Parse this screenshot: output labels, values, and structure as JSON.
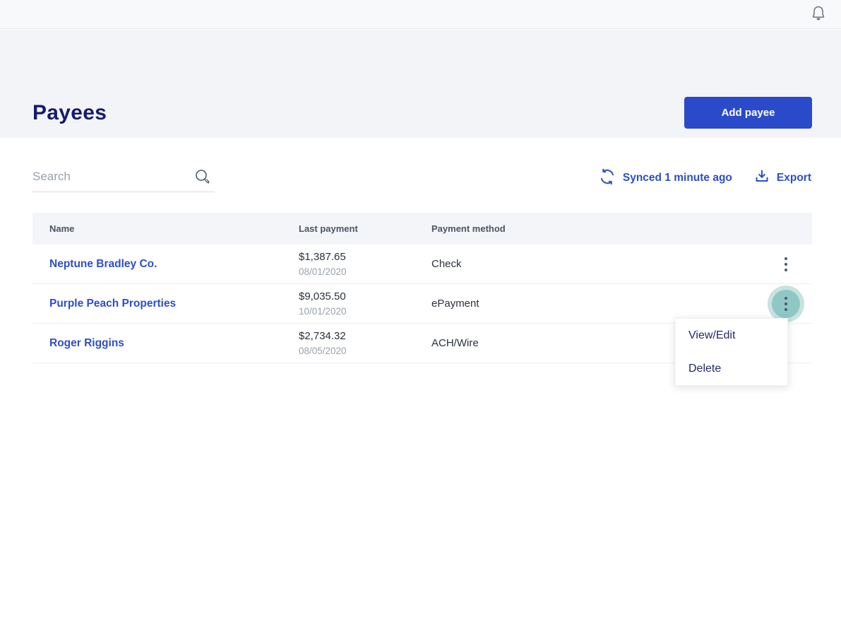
{
  "colors": {
    "accent_blue": "#2d4fc8",
    "button_blue": "#2b4aca",
    "title_navy": "#171b6d",
    "menu_text_navy": "#23296a",
    "teal_highlight_inner": "#8fc7c5",
    "teal_highlight_outer": "#c7e2e1",
    "header_band_gray": "#f3f4f8",
    "table_header_gray": "#f4f5f9"
  },
  "topbar": {
    "notification_icon": "bell-icon"
  },
  "header": {
    "title": "Payees",
    "add_button_label": "Add payee"
  },
  "toolbar": {
    "search_placeholder": "Search",
    "synced_text": "Synced 1 minute ago",
    "export_label": "Export"
  },
  "table": {
    "columns": [
      "Name",
      "Last payment",
      "Payment method"
    ],
    "rows": [
      {
        "name": "Neptune Bradley Co.",
        "last_payment_amount": "$1,387.65",
        "last_payment_date": "08/01/2020",
        "payment_method": "Check"
      },
      {
        "name": "Purple Peach Properties",
        "last_payment_amount": "$9,035.50",
        "last_payment_date": "10/01/2020",
        "payment_method": "ePayment"
      },
      {
        "name": "Roger Riggins",
        "last_payment_amount": "$2,734.32",
        "last_payment_date": "08/05/2020",
        "payment_method": "ACH/Wire"
      }
    ]
  },
  "context_menu": {
    "items": [
      "View/Edit",
      "Delete"
    ]
  }
}
